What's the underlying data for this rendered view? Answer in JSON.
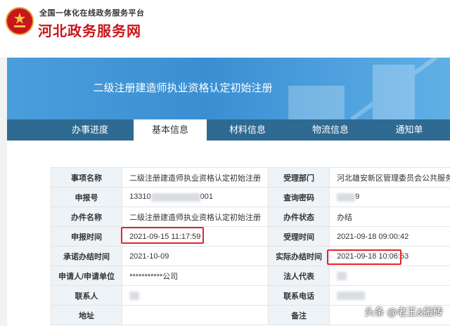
{
  "header": {
    "sub_title": "全国一体化在线政务服务平台",
    "main_title": "河北政务服务网"
  },
  "banner": {
    "title": "二级注册建造师执业资格认定初始注册"
  },
  "tabs": [
    {
      "label": "办事进度",
      "active": false
    },
    {
      "label": "基本信息",
      "active": true
    },
    {
      "label": "材料信息",
      "active": false
    },
    {
      "label": "物流信息",
      "active": false
    },
    {
      "label": "通知单",
      "active": false
    }
  ],
  "info": {
    "item_name_label": "事项名称",
    "item_name": "二级注册建造师执业资格认定初始注册",
    "dept_label": "受理部门",
    "dept": "河北雄安新区管理委员会公共服务局",
    "apply_no_label": "申报号",
    "apply_no_prefix": "13310",
    "apply_no_suffix": "001",
    "query_pwd_label": "查询密码",
    "query_pwd_suffix": "9",
    "case_name_label": "办件名称",
    "case_name": "二级注册建造师执业资格认定初始注册",
    "case_status_label": "办件状态",
    "case_status": "办结",
    "apply_time_label": "申报时间",
    "apply_time": "2021-09-15 11:17:59",
    "accept_time_label": "受理时间",
    "accept_time": "2021-09-18 09:00:42",
    "promise_time_label": "承诺办结时间",
    "promise_time": "2021-10-09",
    "actual_time_label": "实际办结时间",
    "actual_time": "2021-09-18 10:06:53",
    "applicant_label": "申请人/申请单位",
    "applicant": "***********公司",
    "legal_rep_label": "法人代表",
    "contact_label": "联系人",
    "phone_label": "联系电话",
    "address_label": "地址",
    "remark_label": "备注"
  },
  "watermark": "头条 @老王&搬砖",
  "colors": {
    "brand_red": "#c8161d",
    "banner_blue": "#3a8fd3",
    "tab_bar": "#2e6a92",
    "highlight": "#e0262b"
  }
}
